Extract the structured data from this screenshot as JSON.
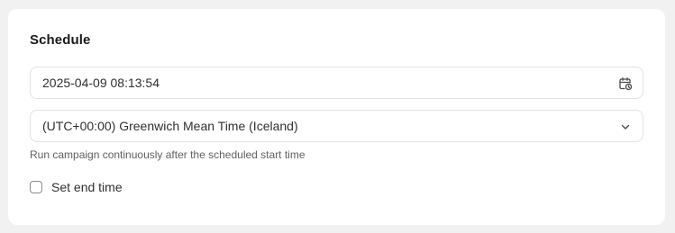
{
  "schedule": {
    "title": "Schedule",
    "datetime": {
      "value": "2025-04-09 08:13:54",
      "icon": "calendar-clock-icon"
    },
    "timezone": {
      "value": "(UTC+00:00) Greenwich Mean Time (Iceland)",
      "icon": "chevron-down-icon"
    },
    "help_text": "Run campaign continuously after the scheduled start time",
    "end_time": {
      "label": "Set end time",
      "checked": false
    }
  }
}
